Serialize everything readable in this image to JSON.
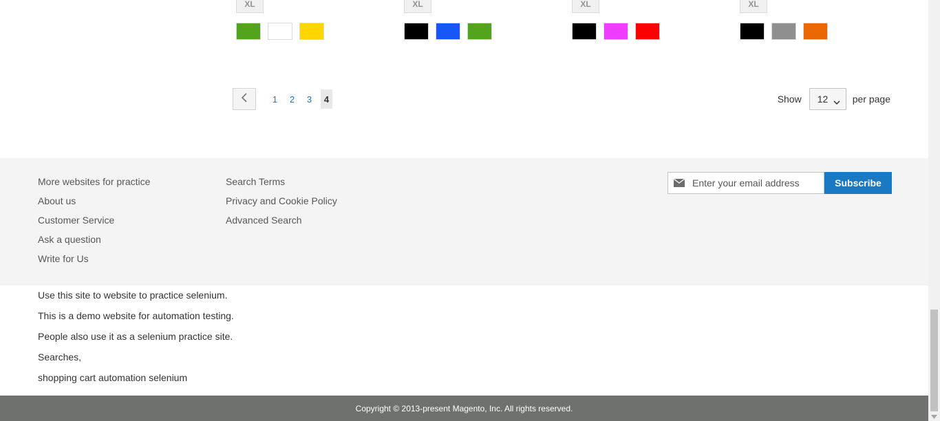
{
  "products": [
    {
      "size_label": "XL",
      "colors": [
        {
          "name": "Green",
          "hex": "#53a41d"
        },
        {
          "name": "White",
          "hex": "#ffffff"
        },
        {
          "name": "Yellow",
          "hex": "#ffd500"
        }
      ]
    },
    {
      "size_label": "XL",
      "colors": [
        {
          "name": "Black",
          "hex": "#000000"
        },
        {
          "name": "Blue",
          "hex": "#1857f7"
        },
        {
          "name": "Green",
          "hex": "#53a41d"
        }
      ]
    },
    {
      "size_label": "XL",
      "colors": [
        {
          "name": "Black",
          "hex": "#000000"
        },
        {
          "name": "Purple",
          "hex": "#ef3dff"
        },
        {
          "name": "Red",
          "hex": "#ff0000"
        }
      ]
    },
    {
      "size_label": "XL",
      "colors": [
        {
          "name": "Black",
          "hex": "#000000"
        },
        {
          "name": "Gray",
          "hex": "#8f8f8f"
        },
        {
          "name": "Orange",
          "hex": "#eb6703"
        }
      ]
    }
  ],
  "pagination": {
    "prev_icon": "chevron-left-icon",
    "pages": [
      "1",
      "2",
      "3"
    ],
    "current_page": "4"
  },
  "limiter": {
    "show_label": "Show",
    "value": "12",
    "per_page_label": "per page"
  },
  "footer": {
    "col1": [
      "More websites for practice",
      "About us",
      "Customer Service",
      "Ask a question",
      "Write for Us"
    ],
    "col2": [
      "Search Terms",
      "Privacy and Cookie Policy",
      "Advanced Search"
    ],
    "newsletter": {
      "placeholder": "Enter your email address",
      "subscribe_label": "Subscribe",
      "icon": "envelope-icon"
    }
  },
  "seo_text": [
    "Use this site to website to practice selenium.",
    "This is a demo website for automation testing.",
    "People also use it as a selenium practice site.",
    "Searches,",
    "shopping cart automation selenium"
  ],
  "copyright": "Copyright © 2013-present Magento, Inc. All rights reserved.",
  "colors": {
    "link": "#1979c3",
    "footer_bg": "#f4f4f4",
    "copyright_bg": "#6e716e",
    "subscribe_bg": "#1979c3"
  }
}
